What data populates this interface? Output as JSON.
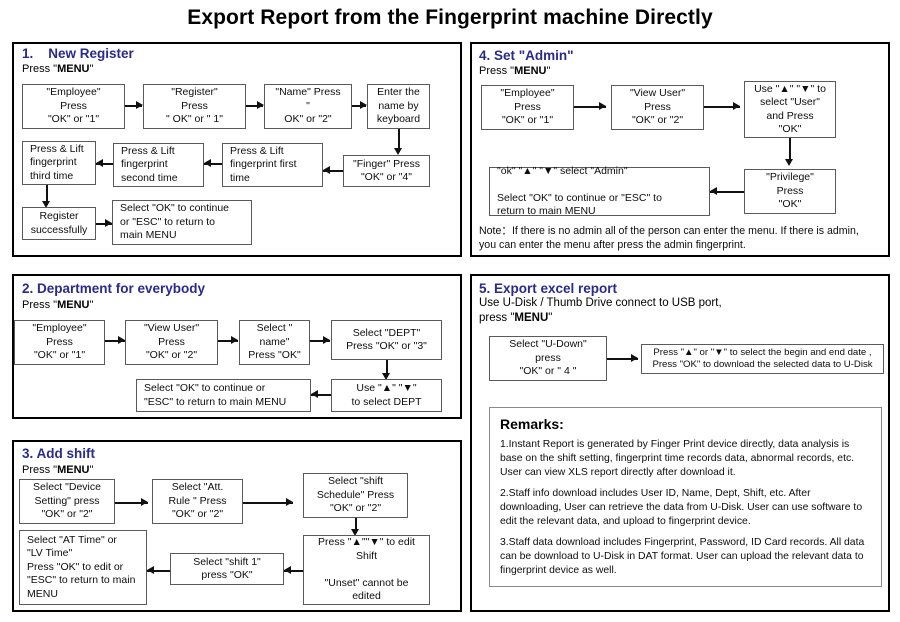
{
  "title": "Export  Report from the Fingerprint machine Directly",
  "sections": [
    {
      "id": "new-register",
      "heading": "1.    New Register",
      "subheading_prefix": "Press \"",
      "subheading_bold": "MENU",
      "subheading_suffix": "\"",
      "boxes": [
        {
          "id": "employee",
          "text": "\"Employee\"\nPress\n\"OK\" or  \"1\""
        },
        {
          "id": "register",
          "text": "\"Register\"\nPress\n\" OK\" or  \" 1\""
        },
        {
          "id": "name",
          "text": "\"Name\" Press\n\"\nOK\" or  \"2\""
        },
        {
          "id": "enter-name",
          "text": "Enter the\nname by\nkeyboard"
        },
        {
          "id": "finger",
          "text": "\"Finger\" Press\n\"OK\" or \"4\""
        },
        {
          "id": "fp-first",
          "text": "Press & Lift\nfingerprint first\ntime"
        },
        {
          "id": "fp-second",
          "text": "Press & Lift\nfingerprint\nsecond time"
        },
        {
          "id": "fp-third",
          "text": "Press & Lift\nfingerprint\nthird time"
        },
        {
          "id": "register-success",
          "text": "Register\nsuccessfully"
        },
        {
          "id": "select-ok-continue",
          "text": "Select \"OK\" to  continue\nor \"ESC\" to return to\nmain MENU"
        }
      ]
    },
    {
      "id": "department",
      "heading": "2. Department for everybody",
      "subheading_prefix": "Press \"",
      "subheading_bold": "MENU",
      "subheading_suffix": "\"",
      "boxes": [
        {
          "id": "employee",
          "text": "\"Employee\"\nPress\n\"OK\" or  \"1\""
        },
        {
          "id": "view-user",
          "text": "\"View User\"\nPress\n\"OK\" or  \"2\""
        },
        {
          "id": "select-name",
          "text": "Select \"\nname\"\nPress \"OK\""
        },
        {
          "id": "select-dept",
          "text": "Select \"DEPT\"\nPress \"OK\" or   \"3\""
        },
        {
          "id": "use-updown",
          "text": "Use  \"▲\"   \"▼\"\nto select DEPT"
        },
        {
          "id": "select-ok-continue",
          "text": "Select \"OK\" to  continue or\n\"ESC\" to return to main MENU"
        }
      ]
    },
    {
      "id": "add-shift",
      "heading": "3. Add shift",
      "subheading_prefix": "Press \"",
      "subheading_bold": "MENU",
      "subheading_suffix": "\"",
      "boxes": [
        {
          "id": "device-setting",
          "text": "Select \"Device\nSetting\" press\n\"OK\" or  \"2\""
        },
        {
          "id": "att-rule",
          "text": "Select \"Att.\nRule \"  Press\n\"OK\" or  \"2\""
        },
        {
          "id": "shift-schedule",
          "text": "Select \"shift\nSchedule\" Press\n\"OK\" or \"2\""
        },
        {
          "id": "edit-shift",
          "text": "Press \"▲\"\"▼\" to edit\nShift\n\n\"Unset\" cannot be\nedited"
        },
        {
          "id": "select-shift1",
          "text": "Select \"shift 1\"\npress  \"OK\""
        },
        {
          "id": "at-lv-time",
          "text": "Select \"AT Time\"   or\n\"LV Time\"\nPress \"OK\" to  edit or\n\"ESC\" to return to main\nMENU"
        }
      ]
    },
    {
      "id": "set-admin",
      "heading": "4. Set \"Admin\"",
      "subheading_prefix": "Press \"",
      "subheading_bold": "MENU",
      "subheading_suffix": "\"",
      "boxes": [
        {
          "id": "employee",
          "text": "\"Employee\"\nPress\n\"OK\" or  \"1\""
        },
        {
          "id": "view-user",
          "text": "\"View User\"\nPress\n\"OK\" or  \"2\""
        },
        {
          "id": "use-updown-user",
          "text": "Use  \"▲\" \"▼\" to\nselect \"User\"\nand  Press\n\"OK\""
        },
        {
          "id": "privilege",
          "text": "\"Privilege\"\nPress\n\"OK\""
        },
        {
          "id": "select-admin",
          "text": "\"ok\" \"▲\" \"▼\" select   \"Admin\"\n\nSelect \"OK\" to  continue or \"ESC\" to\nreturn to main MENU"
        }
      ],
      "note": "Note：If there is no admin all of the person can enter the menu. If there is admin,\nyou can enter the menu after press the admin fingerprint."
    },
    {
      "id": "export-excel",
      "heading": "5. Export excel report",
      "sub_line1": "Use U-Disk / Thumb Drive connect to USB port,",
      "sub_line2_prefix": "press \"",
      "sub_line2_bold": "MENU",
      "sub_line2_suffix": "\"",
      "boxes": [
        {
          "id": "select-udown",
          "text": "Select \"U-Down\"\npress\n\"OK\" or  \" 4 \""
        },
        {
          "id": "select-dates",
          "text": "Press \"▲\" or \"▼\" to select the begin and end date ,\nPress   \"OK\" to download the selected data to U-Disk"
        }
      ]
    }
  ],
  "remarks": {
    "title": "Remarks:",
    "items": [
      "1.Instant Report is generated by Finger Print device directly, data analysis is base on the shift setting, fingerprint time records data, abnormal records, etc. User can view XLS report directly after download it.",
      "2.Staff info download includes User ID, Name, Dept, Shift, etc. After downloading, User can retrieve the data from U-Disk. User can use software to edit the relevant data, and upload to fingerprint device.",
      "3.Staff data download includes Fingerprint, Password, ID Card records. All data can be download to U-Disk in DAT format. User can upload the relevant data to fingerprint device as well."
    ]
  },
  "colors": {
    "heading": "#2a2a8c",
    "text": "#0d0d0d",
    "panel_border": "#000000",
    "box_border": "#5a5a5a"
  }
}
